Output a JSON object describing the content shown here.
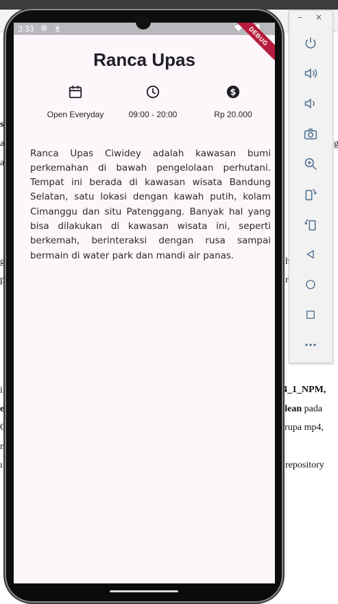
{
  "background_doc": {
    "lines": [
      {
        "text": "si",
        "bold": true
      },
      {
        "text": "a",
        "bold": false
      },
      {
        "text": "a",
        "bold": false
      },
      {
        "text": "g",
        "bold": false
      },
      {
        "text": "p",
        "bold": false
      },
      {
        "text": "il",
        "bold": false
      },
      {
        "text": "e",
        "bold": true
      },
      {
        "text": "C",
        "bold": false
      },
      {
        "text": "n",
        "bold": false
      },
      {
        "text": "ık",
        "bold": false
      }
    ],
    "right_lines": [
      {
        "text": "g.",
        "bold": false
      },
      {
        "text": "h",
        "bold": false
      },
      {
        "text": "r",
        "bold": false
      },
      {
        "text": "4_1_NPM,",
        "bold": true
      },
      {
        "text": "clean pada",
        "bold": false
      },
      {
        "text": "erupa mp4,",
        "bold": false
      },
      {
        "text": "repository",
        "bold": false
      }
    ]
  },
  "status_bar": {
    "time": "3:33",
    "debug_label": "DEBUG"
  },
  "app": {
    "title": "Ranca Upas",
    "info": [
      {
        "icon": "calendar-icon",
        "label": "Open Everyday"
      },
      {
        "icon": "clock-icon",
        "label": "09:00 - 20:00"
      },
      {
        "icon": "dollar-icon",
        "label": "Rp 20.000"
      }
    ],
    "description": "Ranca Upas Ciwidey adalah kawasan bumi perkemahan di bawah pengelolaan perhutani. Tempat ini berada di kawasan wisata Bandung Selatan, satu lokasi dengan kawah putih, kolam Cimanggu dan situ Patenggang. Banyak hal yang bisa dilakukan di kawasan wisata ini, seperti berkemah, berinteraksi dengan rusa sampai bermain di water park dan mandi air panas."
  },
  "emulator_toolbar": {
    "minimize_label": "–",
    "close_label": "×",
    "buttons": [
      "power-icon",
      "volume-up-icon",
      "volume-down-icon",
      "camera-icon",
      "zoom-icon",
      "rotate-left-icon",
      "rotate-right-icon",
      "back-icon",
      "home-icon",
      "overview-icon",
      "more-icon"
    ]
  }
}
